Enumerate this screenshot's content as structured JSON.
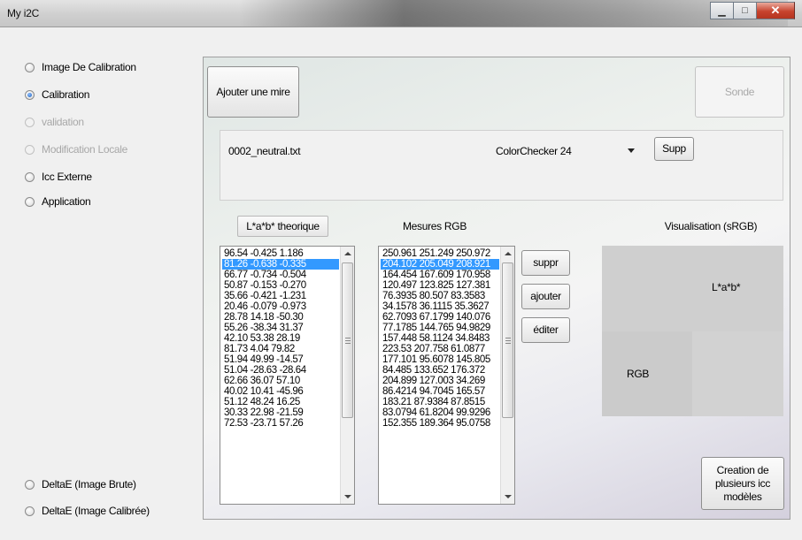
{
  "window": {
    "title": "My i2C"
  },
  "modes": [
    {
      "label": "Image De Calibration",
      "checked": false,
      "enabled": true
    },
    {
      "label": "Calibration",
      "checked": true,
      "enabled": true
    },
    {
      "label": "validation",
      "checked": false,
      "enabled": false
    },
    {
      "label": "Modification Locale",
      "checked": false,
      "enabled": false
    },
    {
      "label": "Icc Externe",
      "checked": false,
      "enabled": true
    },
    {
      "label": "Application",
      "checked": false,
      "enabled": true
    }
  ],
  "delta_options": [
    {
      "label": "DeltaE (Image Brute)",
      "checked": false
    },
    {
      "label": "DeltaE (Image Calibrée)",
      "checked": false
    }
  ],
  "toolbar": {
    "add_chart_label": "Ajouter une mire",
    "probe_label": "Sonde"
  },
  "chart_info": {
    "filename": "0002_neutral.txt",
    "chart_type": "ColorChecker 24",
    "delete_label": "Supp"
  },
  "columns": {
    "lab_header": "L*a*b* theorique",
    "rgb_header": "Mesures RGB",
    "vis_header": "Visualisation (sRGB)"
  },
  "lab_values": [
    "96.54 -0.425 1.186",
    "81.26 -0.638 -0.335",
    "66.77 -0.734 -0.504",
    "50.87 -0.153 -0.270",
    "35.66 -0.421 -1.231",
    "20.46 -0.079 -0.973",
    "28.78 14.18 -50.30",
    "55.26 -38.34 31.37",
    "42.10 53.38 28.19",
    "81.73 4.04 79.82",
    "51.94 49.99 -14.57",
    "51.04 -28.63 -28.64",
    "62.66 36.07 57.10",
    "40.02 10.41 -45.96",
    "51.12 48.24 16.25",
    "30.33 22.98 -21.59",
    "72.53 -23.71 57.26"
  ],
  "rgb_values": [
    "250.961 251.249 250.972",
    "204.102 205.049 208.921",
    "164.454 167.609 170.958",
    "120.497 123.825 127.381",
    "76.3935 80.507 83.3583",
    "34.1578 36.1115 35.3627",
    "62.7093 67.1799 140.076",
    "77.1785 144.765 94.9829",
    "157.448 58.1124 34.8483",
    "223.53 207.758 61.0877",
    "177.101 95.6078 145.805",
    "84.485 133.652 176.372",
    "204.899 127.003 34.269",
    "86.4214 94.7045 165.57",
    "183.21 87.9384 87.8515",
    "83.0794 61.8204 99.9296",
    "152.355 189.364 95.0758"
  ],
  "selected_index": 1,
  "actions": {
    "delete_label": "suppr",
    "add_label": "ajouter",
    "edit_label": "éditer"
  },
  "visualisation": {
    "lab_label": "L*a*b*",
    "rgb_label": "RGB"
  },
  "create_icc_label": "Creation de plusieurs icc modèles"
}
